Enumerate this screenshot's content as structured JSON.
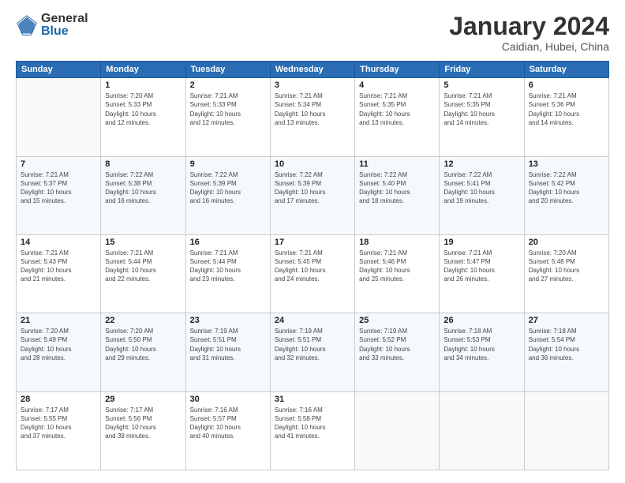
{
  "header": {
    "logo_general": "General",
    "logo_blue": "Blue",
    "month_title": "January 2024",
    "location": "Caidian, Hubei, China"
  },
  "days_of_week": [
    "Sunday",
    "Monday",
    "Tuesday",
    "Wednesday",
    "Thursday",
    "Friday",
    "Saturday"
  ],
  "weeks": [
    [
      {
        "num": "",
        "info": ""
      },
      {
        "num": "1",
        "info": "Sunrise: 7:20 AM\nSunset: 5:33 PM\nDaylight: 10 hours\nand 12 minutes."
      },
      {
        "num": "2",
        "info": "Sunrise: 7:21 AM\nSunset: 5:33 PM\nDaylight: 10 hours\nand 12 minutes."
      },
      {
        "num": "3",
        "info": "Sunrise: 7:21 AM\nSunset: 5:34 PM\nDaylight: 10 hours\nand 13 minutes."
      },
      {
        "num": "4",
        "info": "Sunrise: 7:21 AM\nSunset: 5:35 PM\nDaylight: 10 hours\nand 13 minutes."
      },
      {
        "num": "5",
        "info": "Sunrise: 7:21 AM\nSunset: 5:35 PM\nDaylight: 10 hours\nand 14 minutes."
      },
      {
        "num": "6",
        "info": "Sunrise: 7:21 AM\nSunset: 5:36 PM\nDaylight: 10 hours\nand 14 minutes."
      }
    ],
    [
      {
        "num": "7",
        "info": "Sunrise: 7:21 AM\nSunset: 5:37 PM\nDaylight: 10 hours\nand 15 minutes."
      },
      {
        "num": "8",
        "info": "Sunrise: 7:22 AM\nSunset: 5:38 PM\nDaylight: 10 hours\nand 16 minutes."
      },
      {
        "num": "9",
        "info": "Sunrise: 7:22 AM\nSunset: 5:39 PM\nDaylight: 10 hours\nand 16 minutes."
      },
      {
        "num": "10",
        "info": "Sunrise: 7:22 AM\nSunset: 5:39 PM\nDaylight: 10 hours\nand 17 minutes."
      },
      {
        "num": "11",
        "info": "Sunrise: 7:22 AM\nSunset: 5:40 PM\nDaylight: 10 hours\nand 18 minutes."
      },
      {
        "num": "12",
        "info": "Sunrise: 7:22 AM\nSunset: 5:41 PM\nDaylight: 10 hours\nand 19 minutes."
      },
      {
        "num": "13",
        "info": "Sunrise: 7:22 AM\nSunset: 5:42 PM\nDaylight: 10 hours\nand 20 minutes."
      }
    ],
    [
      {
        "num": "14",
        "info": "Sunrise: 7:21 AM\nSunset: 5:43 PM\nDaylight: 10 hours\nand 21 minutes."
      },
      {
        "num": "15",
        "info": "Sunrise: 7:21 AM\nSunset: 5:44 PM\nDaylight: 10 hours\nand 22 minutes."
      },
      {
        "num": "16",
        "info": "Sunrise: 7:21 AM\nSunset: 5:44 PM\nDaylight: 10 hours\nand 23 minutes."
      },
      {
        "num": "17",
        "info": "Sunrise: 7:21 AM\nSunset: 5:45 PM\nDaylight: 10 hours\nand 24 minutes."
      },
      {
        "num": "18",
        "info": "Sunrise: 7:21 AM\nSunset: 5:46 PM\nDaylight: 10 hours\nand 25 minutes."
      },
      {
        "num": "19",
        "info": "Sunrise: 7:21 AM\nSunset: 5:47 PM\nDaylight: 10 hours\nand 26 minutes."
      },
      {
        "num": "20",
        "info": "Sunrise: 7:20 AM\nSunset: 5:48 PM\nDaylight: 10 hours\nand 27 minutes."
      }
    ],
    [
      {
        "num": "21",
        "info": "Sunrise: 7:20 AM\nSunset: 5:49 PM\nDaylight: 10 hours\nand 28 minutes."
      },
      {
        "num": "22",
        "info": "Sunrise: 7:20 AM\nSunset: 5:50 PM\nDaylight: 10 hours\nand 29 minutes."
      },
      {
        "num": "23",
        "info": "Sunrise: 7:19 AM\nSunset: 5:51 PM\nDaylight: 10 hours\nand 31 minutes."
      },
      {
        "num": "24",
        "info": "Sunrise: 7:19 AM\nSunset: 5:51 PM\nDaylight: 10 hours\nand 32 minutes."
      },
      {
        "num": "25",
        "info": "Sunrise: 7:19 AM\nSunset: 5:52 PM\nDaylight: 10 hours\nand 33 minutes."
      },
      {
        "num": "26",
        "info": "Sunrise: 7:18 AM\nSunset: 5:53 PM\nDaylight: 10 hours\nand 34 minutes."
      },
      {
        "num": "27",
        "info": "Sunrise: 7:18 AM\nSunset: 5:54 PM\nDaylight: 10 hours\nand 36 minutes."
      }
    ],
    [
      {
        "num": "28",
        "info": "Sunrise: 7:17 AM\nSunset: 5:55 PM\nDaylight: 10 hours\nand 37 minutes."
      },
      {
        "num": "29",
        "info": "Sunrise: 7:17 AM\nSunset: 5:56 PM\nDaylight: 10 hours\nand 39 minutes."
      },
      {
        "num": "30",
        "info": "Sunrise: 7:16 AM\nSunset: 5:57 PM\nDaylight: 10 hours\nand 40 minutes."
      },
      {
        "num": "31",
        "info": "Sunrise: 7:16 AM\nSunset: 5:58 PM\nDaylight: 10 hours\nand 41 minutes."
      },
      {
        "num": "",
        "info": ""
      },
      {
        "num": "",
        "info": ""
      },
      {
        "num": "",
        "info": ""
      }
    ]
  ]
}
